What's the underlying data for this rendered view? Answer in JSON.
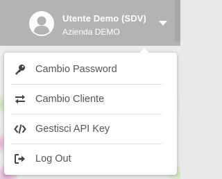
{
  "header": {
    "user_name": "Utente Demo (SDV)",
    "company": "Azienda DEMO",
    "avatar_icon": "user-circle-icon",
    "caret_icon": "caret-down-icon"
  },
  "menu": {
    "items": [
      {
        "label": "Cambio Password",
        "icon": "key-icon"
      },
      {
        "label": "Cambio Cliente",
        "icon": "exchange-arrows-icon"
      },
      {
        "label": "Gestisci API Key",
        "icon": "code-icon"
      },
      {
        "label": "Log Out",
        "icon": "sign-out-icon"
      }
    ]
  },
  "colors": {
    "header_bg": "#b3b3b3",
    "menu_text": "#555555",
    "icon": "#444444"
  }
}
